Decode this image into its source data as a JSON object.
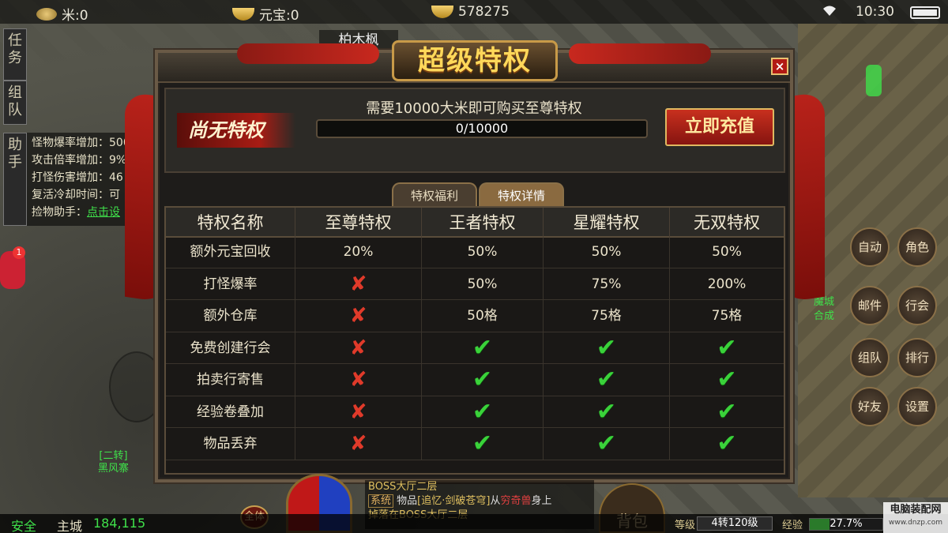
{
  "topbar": {
    "rice": "米:0",
    "yuanbao": "元宝:0",
    "gold": "578275",
    "time": "10:30"
  },
  "left_hud": {
    "task_tab": "任务",
    "team_tab": "组队",
    "assist_tab": "助手",
    "assist_lines": [
      "怪物爆率增加：500",
      "攻击倍率增加：9%",
      "打怪伤害增加：46",
      "复活冷却时间：可"
    ],
    "pickup_label": "捡物助手：",
    "pickup_link": "点击设",
    "gamepad_badge": "1",
    "npc_lines": [
      "[二转]",
      "黑风寨"
    ]
  },
  "player_name": "柏木枫",
  "modal": {
    "title": "超级特权",
    "close": "×",
    "status": "尚无特权",
    "requirement": "需要10000大米即可购买至尊特权",
    "progress_text": "0/10000",
    "progress_value": 0,
    "recharge_button": "立即充值",
    "tabs": [
      "特权福利",
      "特权详情"
    ],
    "active_tab": 1,
    "headers": [
      "特权名称",
      "至尊特权",
      "王者特权",
      "星耀特权",
      "无双特权"
    ],
    "rows": [
      [
        "额外元宝回收",
        "20%",
        "50%",
        "50%",
        "50%"
      ],
      [
        "打怪爆率",
        "cross",
        "50%",
        "75%",
        "200%"
      ],
      [
        "额外仓库",
        "cross",
        "50格",
        "75格",
        "75格"
      ],
      [
        "免费创建行会",
        "cross",
        "check",
        "check",
        "check"
      ],
      [
        "拍卖行寄售",
        "cross",
        "check",
        "check",
        "check"
      ],
      [
        "经验卷叠加",
        "cross",
        "check",
        "check",
        "check"
      ],
      [
        "物品丢弃",
        "cross",
        "check",
        "check",
        "check"
      ]
    ]
  },
  "right_hud": {
    "buttons": [
      "自动",
      "角色",
      "邮件",
      "行会",
      "组队",
      "排行",
      "好友",
      "设置"
    ],
    "side_labels": [
      "魔城",
      "合成"
    ]
  },
  "bottom": {
    "safe": "安全",
    "zone": "主城",
    "coords": "184,115",
    "all_button": "全体",
    "chat_line1": "BOSS大厅二层",
    "chat_sys": "系统",
    "chat_text_a": "物品",
    "chat_item": "[追忆·剑破苍穹]",
    "chat_text_b": "从",
    "chat_player": "穷奇兽",
    "chat_text_c": "身上",
    "chat_line3": "掉落在BOSS大厅二层",
    "bag": "背包",
    "level_label": "等级",
    "level": "4转120级",
    "exp_label": "经验",
    "exp_percent": "27.7%",
    "exp_value": 27.7,
    "watermark_title": "电脑装配网",
    "watermark_url": "www.dnzp.com"
  },
  "colors": {
    "accent_gold": "#ffd85a",
    "check_green": "#3ad23a",
    "cross_red": "#e03a2a",
    "recharge_red": "#c8301e"
  }
}
